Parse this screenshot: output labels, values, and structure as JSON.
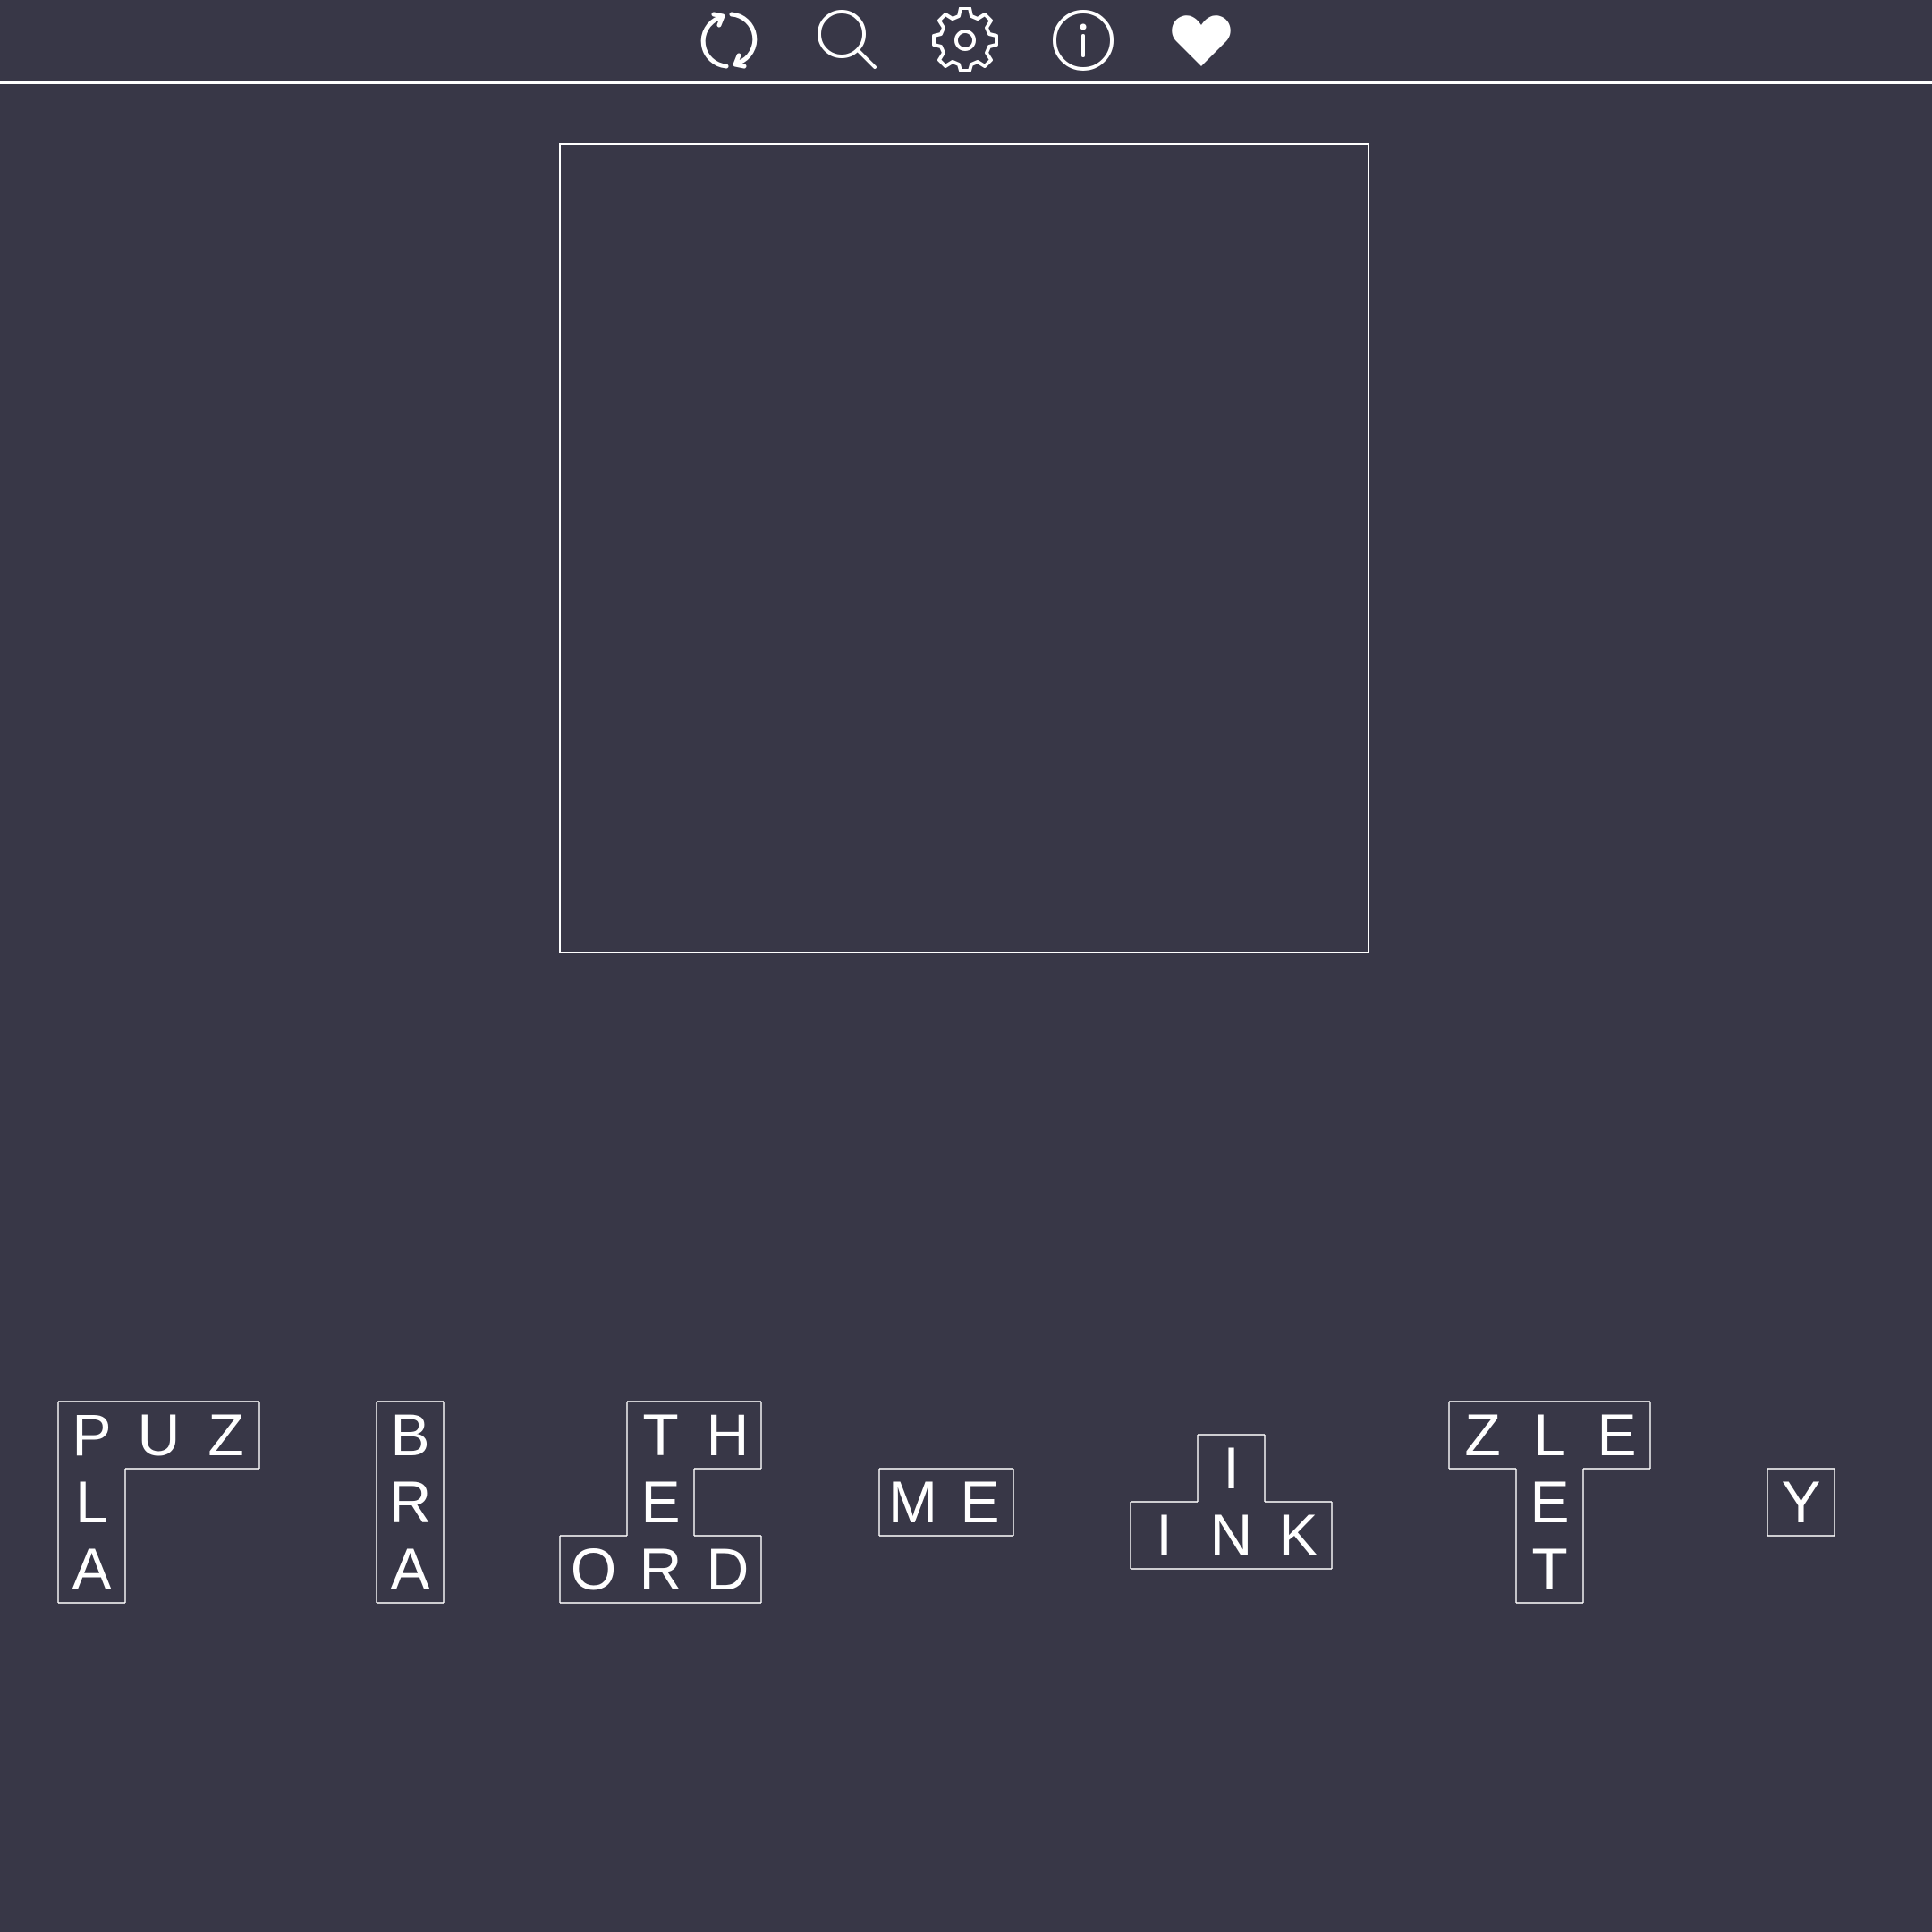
{
  "toolbar": {
    "buttons": [
      {
        "name": "restart-icon"
      },
      {
        "name": "search-icon"
      },
      {
        "name": "gear-icon"
      },
      {
        "name": "info-icon"
      },
      {
        "name": "heart-icon"
      }
    ]
  },
  "board": {},
  "pieces": [
    {
      "letters": [
        "P",
        "U",
        "Z",
        "L",
        "A"
      ]
    },
    {
      "letters": [
        "B",
        "R",
        "A"
      ]
    },
    {
      "letters": [
        "T",
        "H",
        "E",
        "O",
        "R",
        "D"
      ]
    },
    {
      "letters": [
        "M",
        "E"
      ]
    },
    {
      "letters": [
        "I",
        "I",
        "N",
        "K"
      ]
    },
    {
      "letters": [
        "Z",
        "L",
        "E",
        "E",
        "T"
      ]
    },
    {
      "letters": [
        "Y"
      ]
    }
  ],
  "colors": {
    "background": "#383747",
    "foreground": "#ffffff"
  }
}
